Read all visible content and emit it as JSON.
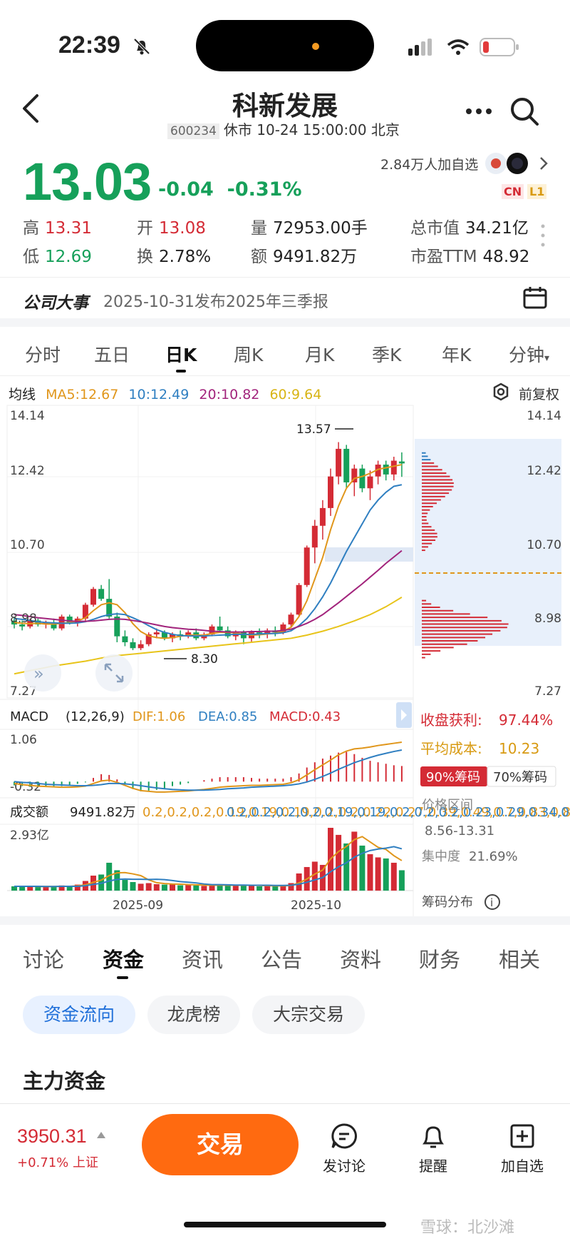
{
  "status": {
    "time": "22:39"
  },
  "header": {
    "title": "科新发展",
    "code": "600234",
    "market_status": "休市 10-24 15:00:00 北京"
  },
  "quote": {
    "price": "13.03",
    "change": "-0.04",
    "change_pct": "-0.31%",
    "followers": "2.84万人加自选",
    "badges": [
      "CN",
      "L1"
    ],
    "high_label": "高",
    "high": "13.31",
    "open_label": "开",
    "open": "13.08",
    "volume_label": "量",
    "volume": "72953.00手",
    "mktcap_label": "总市值",
    "mktcap": "34.21亿",
    "low_label": "低",
    "low": "12.69",
    "turnover_label": "换",
    "turnover": "2.78%",
    "amount_label": "额",
    "amount": "9491.82万",
    "pe_label": "市盈TTM",
    "pe": "48.92"
  },
  "events": {
    "title": "公司大事",
    "text": "2025-10-31发布2025年三季报"
  },
  "k_tabs": [
    "分时",
    "五日",
    "日K",
    "周K",
    "月K",
    "季K",
    "年K",
    "分钟"
  ],
  "ma": {
    "label": "均线",
    "ma5": "MA5:12.67",
    "ma10": "10:12.49",
    "ma20": "20:10.82",
    "ma60": "60:9.64",
    "fuquan": "前复权"
  },
  "colors": {
    "up": "#d42b35",
    "down": "#16a05a",
    "ma5": "#e0961b",
    "ma10": "#2f7fc1",
    "ma20": "#a2247c",
    "ma60": "#e8c41a",
    "accent": "#ff6a10"
  },
  "chart_data": {
    "type": "candlestick",
    "price_axis": [
      "14.14",
      "12.42",
      "10.70",
      "8.98",
      "7.27"
    ],
    "ylim": [
      7.27,
      14.14
    ],
    "annotations": {
      "high": "13.57",
      "low": "8.30"
    },
    "date_labels": [
      "2025-09",
      "2025-10"
    ],
    "candles": [
      [
        9.05,
        9.15,
        8.85,
        8.95
      ],
      [
        8.95,
        9.05,
        8.8,
        8.9
      ],
      [
        8.9,
        9.1,
        8.85,
        9.05
      ],
      [
        9.05,
        9.1,
        8.9,
        8.95
      ],
      [
        8.95,
        9.05,
        8.85,
        9.0
      ],
      [
        9.0,
        9.1,
        8.8,
        8.85
      ],
      [
        8.85,
        9.2,
        8.8,
        9.15
      ],
      [
        9.15,
        9.2,
        8.95,
        9.0
      ],
      [
        9.0,
        9.15,
        8.9,
        9.1
      ],
      [
        9.1,
        9.5,
        9.05,
        9.45
      ],
      [
        9.45,
        9.9,
        9.4,
        9.85
      ],
      [
        9.85,
        9.95,
        9.55,
        9.6
      ],
      [
        9.6,
        10.1,
        9.1,
        9.15
      ],
      [
        9.15,
        9.25,
        8.5,
        8.65
      ],
      [
        8.65,
        8.8,
        8.4,
        8.5
      ],
      [
        8.5,
        8.6,
        8.3,
        8.35
      ],
      [
        8.35,
        8.55,
        8.3,
        8.45
      ],
      [
        8.45,
        8.75,
        8.4,
        8.7
      ],
      [
        8.7,
        8.85,
        8.6,
        8.75
      ],
      [
        8.75,
        8.8,
        8.55,
        8.6
      ],
      [
        8.6,
        8.75,
        8.5,
        8.7
      ],
      [
        8.7,
        8.8,
        8.55,
        8.65
      ],
      [
        8.65,
        8.8,
        8.6,
        8.75
      ],
      [
        8.75,
        8.85,
        8.55,
        8.6
      ],
      [
        8.6,
        8.75,
        8.55,
        8.7
      ],
      [
        8.7,
        8.95,
        8.65,
        8.9
      ],
      [
        8.9,
        9.15,
        8.75,
        8.8
      ],
      [
        8.8,
        8.9,
        8.6,
        8.65
      ],
      [
        8.65,
        8.8,
        8.55,
        8.75
      ],
      [
        8.75,
        8.8,
        8.45,
        8.6
      ],
      [
        8.6,
        8.8,
        8.5,
        8.75
      ],
      [
        8.75,
        8.85,
        8.6,
        8.7
      ],
      [
        8.7,
        8.85,
        8.6,
        8.8
      ],
      [
        8.8,
        8.9,
        8.65,
        8.75
      ],
      [
        8.75,
        9.0,
        8.7,
        8.95
      ],
      [
        8.95,
        9.25,
        8.9,
        9.2
      ],
      [
        9.2,
        10.0,
        9.15,
        9.95
      ],
      [
        9.95,
        10.95,
        9.9,
        10.9
      ],
      [
        10.9,
        11.6,
        10.5,
        11.45
      ],
      [
        11.45,
        12.1,
        11.1,
        11.9
      ],
      [
        11.9,
        12.9,
        11.7,
        12.7
      ],
      [
        12.7,
        13.57,
        12.5,
        13.4
      ],
      [
        13.4,
        13.5,
        12.4,
        12.55
      ],
      [
        12.55,
        13.0,
        12.2,
        12.9
      ],
      [
        12.9,
        13.0,
        12.3,
        12.4
      ],
      [
        12.4,
        12.85,
        12.1,
        12.7
      ],
      [
        12.7,
        13.1,
        12.5,
        13.0
      ],
      [
        13.0,
        13.1,
        12.6,
        12.75
      ],
      [
        12.75,
        13.2,
        12.6,
        13.1
      ],
      [
        13.08,
        13.31,
        12.69,
        13.03
      ]
    ],
    "ma_lines": {
      "ma5": [
        9.0,
        8.98,
        8.97,
        8.98,
        8.96,
        8.96,
        8.98,
        9.0,
        9.04,
        9.12,
        9.3,
        9.45,
        9.5,
        9.45,
        9.25,
        8.97,
        8.77,
        8.66,
        8.62,
        8.6,
        8.62,
        8.65,
        8.68,
        8.68,
        8.68,
        8.72,
        8.75,
        8.75,
        8.74,
        8.7,
        8.68,
        8.69,
        8.71,
        8.73,
        8.78,
        8.88,
        9.15,
        9.55,
        10.1,
        10.65,
        11.35,
        11.95,
        12.4,
        12.65,
        12.7,
        12.78,
        12.88,
        12.92,
        12.96,
        13.0
      ],
      "ma10": [
        9.1,
        9.08,
        9.05,
        9.02,
        9.0,
        8.99,
        8.98,
        8.98,
        8.99,
        9.02,
        9.08,
        9.15,
        9.2,
        9.22,
        9.2,
        9.12,
        9.03,
        8.92,
        8.82,
        8.75,
        8.7,
        8.67,
        8.66,
        8.66,
        8.66,
        8.67,
        8.68,
        8.69,
        8.7,
        8.7,
        8.7,
        8.71,
        8.72,
        8.72,
        8.74,
        8.79,
        8.92,
        9.1,
        9.35,
        9.65,
        10.0,
        10.4,
        10.8,
        11.15,
        11.5,
        11.85,
        12.1,
        12.3,
        12.45,
        12.49
      ],
      "ma20": [
        9.2,
        9.18,
        9.15,
        9.12,
        9.1,
        9.08,
        9.06,
        9.04,
        9.03,
        9.03,
        9.04,
        9.06,
        9.08,
        9.09,
        9.08,
        9.05,
        9.02,
        8.98,
        8.94,
        8.9,
        8.87,
        8.85,
        8.83,
        8.82,
        8.8,
        8.78,
        8.77,
        8.76,
        8.76,
        8.76,
        8.77,
        8.77,
        8.78,
        8.78,
        8.8,
        8.83,
        8.9,
        8.98,
        9.08,
        9.2,
        9.35,
        9.5,
        9.66,
        9.82,
        9.98,
        10.15,
        10.32,
        10.5,
        10.66,
        10.82
      ],
      "ma60": [
        7.7,
        7.74,
        7.78,
        7.82,
        7.86,
        7.9,
        7.93,
        7.96,
        7.99,
        8.02,
        8.06,
        8.1,
        8.13,
        8.16,
        8.18,
        8.2,
        8.22,
        8.24,
        8.26,
        8.28,
        8.3,
        8.32,
        8.34,
        8.36,
        8.38,
        8.4,
        8.42,
        8.44,
        8.46,
        8.48,
        8.5,
        8.52,
        8.54,
        8.56,
        8.58,
        8.6,
        8.64,
        8.68,
        8.73,
        8.78,
        8.84,
        8.9,
        8.97,
        9.04,
        9.12,
        9.2,
        9.3,
        9.4,
        9.52,
        9.64
      ]
    },
    "chip": {
      "profit_label": "收盘获利:",
      "profit": "97.44%",
      "avg_label": "平均成本:",
      "avg": "10.23",
      "tab90": "90%筹码",
      "tab70": "70%筹码",
      "range_label": "价格区间",
      "range": "8.56-13.31",
      "conc_label": "集中度",
      "conc": "21.69%",
      "dist_label": "筹码分布"
    },
    "macd": {
      "label": "MACD",
      "params": "(12,26,9)",
      "dif": "DIF:1.06",
      "dea": "DEA:0.85",
      "macd": "MACD:0.43",
      "axis": [
        "1.06",
        "-0.32"
      ],
      "dif_line": [
        -0.05,
        -0.08,
        -0.1,
        -0.12,
        -0.13,
        -0.14,
        -0.15,
        -0.15,
        -0.14,
        -0.12,
        -0.05,
        0.02,
        0.04,
        -0.02,
        -0.1,
        -0.18,
        -0.24,
        -0.26,
        -0.28,
        -0.28,
        -0.27,
        -0.26,
        -0.25,
        -0.23,
        -0.21,
        -0.18,
        -0.15,
        -0.13,
        -0.12,
        -0.11,
        -0.1,
        -0.1,
        -0.09,
        -0.08,
        -0.07,
        -0.03,
        0.05,
        0.18,
        0.32,
        0.45,
        0.58,
        0.72,
        0.82,
        0.88,
        0.9,
        0.93,
        0.97,
        1.0,
        1.03,
        1.06
      ],
      "dea_line": [
        0.0,
        -0.02,
        -0.03,
        -0.05,
        -0.07,
        -0.08,
        -0.09,
        -0.1,
        -0.11,
        -0.11,
        -0.1,
        -0.08,
        -0.05,
        -0.05,
        -0.06,
        -0.08,
        -0.11,
        -0.14,
        -0.17,
        -0.19,
        -0.21,
        -0.22,
        -0.23,
        -0.23,
        -0.23,
        -0.22,
        -0.21,
        -0.19,
        -0.18,
        -0.17,
        -0.15,
        -0.14,
        -0.13,
        -0.12,
        -0.11,
        -0.09,
        -0.06,
        -0.01,
        0.06,
        0.14,
        0.23,
        0.33,
        0.42,
        0.51,
        0.58,
        0.65,
        0.71,
        0.76,
        0.81,
        0.85
      ]
    },
    "volume": {
      "label": "成交额",
      "value": "9491.82万",
      "ma5": [
        0.2,
        0.2,
        0.2,
        0.19,
        0.19,
        0.19,
        0.2,
        0.2,
        0.22,
        0.27,
        0.39,
        0.49,
        0.7,
        0.83,
        0.84,
        0.78,
        0.7,
        0.5,
        0.37,
        0.33,
        0.31,
        0.3,
        0.28,
        0.27,
        0.26,
        0.25,
        0.26,
        0.25,
        0.25,
        0.25,
        0.25,
        0.24,
        0.23,
        0.22,
        0.22,
        0.24,
        0.36,
        0.54,
        0.77,
        0.96,
        1.48,
        1.82,
        2.06,
        2.38,
        2.52,
        2.27,
        2.02,
        1.92,
        1.63,
        1.4
      ],
      "ma10": [
        0.2,
        0.2,
        0.2,
        0.2,
        0.19,
        0.19,
        0.2,
        0.2,
        0.2,
        0.23,
        0.29,
        0.34,
        0.45,
        0.52,
        0.54,
        0.53,
        0.53,
        0.52,
        0.53,
        0.51,
        0.47,
        0.42,
        0.39,
        0.36,
        0.31,
        0.28,
        0.28,
        0.27,
        0.26,
        0.26,
        0.25,
        0.25,
        0.25,
        0.24,
        0.24,
        0.25,
        0.3,
        0.39,
        0.5,
        0.61,
        0.88,
        1.11,
        1.3,
        1.56,
        1.74,
        1.87,
        1.94,
        1.98,
        2.05,
        1.95
      ],
      "axis": "2.93亿",
      "bars": [
        0.2,
        0.18,
        0.22,
        0.17,
        0.19,
        0.2,
        0.24,
        0.2,
        0.28,
        0.45,
        0.7,
        0.75,
        1.3,
        0.95,
        0.5,
        0.4,
        0.32,
        0.35,
        0.3,
        0.28,
        0.3,
        0.25,
        0.28,
        0.24,
        0.22,
        0.25,
        0.3,
        0.24,
        0.22,
        0.26,
        0.22,
        0.2,
        0.22,
        0.2,
        0.24,
        0.35,
        0.8,
        1.1,
        1.35,
        1.2,
        2.93,
        2.6,
        2.2,
        2.75,
        2.1,
        1.7,
        1.55,
        1.5,
        1.3,
        0.95
      ]
    }
  },
  "info_tabs": [
    "讨论",
    "资金",
    "资讯",
    "公告",
    "资料",
    "财务",
    "相关"
  ],
  "fund_pills": [
    "资金流向",
    "龙虎榜",
    "大宗交易"
  ],
  "main_funds_title": "主力资金",
  "bottom": {
    "index_value": "3950.31",
    "index_change": "+0.71%",
    "index_name": "上证",
    "trade": "交易",
    "actions": [
      "发讨论",
      "提醒",
      "加自选"
    ]
  },
  "watermark": "雪球：北沙滩"
}
